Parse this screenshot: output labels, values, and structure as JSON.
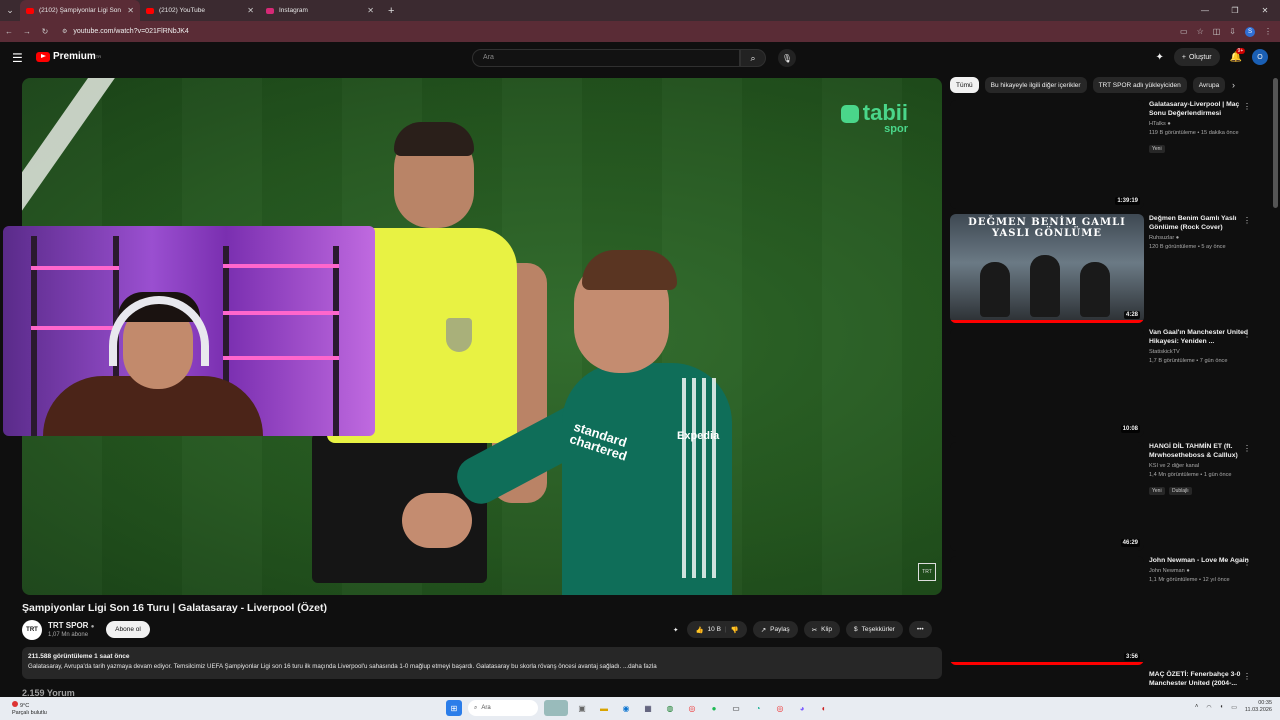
{
  "browser": {
    "tabs": [
      {
        "title": "(2102) Şampiyonlar Ligi Son 16",
        "active": true,
        "color": "#ff0000"
      },
      {
        "title": "(2102) YouTube",
        "active": false,
        "color": "#ff0000"
      },
      {
        "title": "Instagram",
        "active": false,
        "color": "#d62976"
      }
    ],
    "url": "youtube.com/watch?v=021FlRNbJK4",
    "profile_initial": "S"
  },
  "header": {
    "brand": "Premium",
    "brand_sup": "TR",
    "search_placeholder": "Ara",
    "create_label": "Oluştur",
    "notif_badge": "9+",
    "avatar_initial": "O"
  },
  "video": {
    "overlay_brand": "tabii",
    "overlay_sub": "spor",
    "sponsor": "standard chartered",
    "shirt_sponsor2": "Expedia",
    "watermark": "TRT",
    "title": "Şampiyonlar Ligi Son 16 Turu | Galatasaray - Liverpool (Özet)",
    "channel": {
      "name": "TRT SPOR",
      "subs": "1,07 Mn abone",
      "avatar_text": "TRT"
    },
    "subscribe_label": "Abone ol",
    "likes": "10 B",
    "share_label": "Paylaş",
    "clip_label": "Klip",
    "thanks_label": "Teşekkürler",
    "views_line": "211.588 görüntüleme  1 saat önce",
    "description": "Galatasaray, Avrupa'da tarih yazmaya devam ediyor. Temsilcimiz UEFA Şampiyonlar Ligi son 16 turu ilk maçında Liverpool'u sahasında 1-0 mağlup etmeyi başardı. Galatasaray bu skorla rövanş öncesi avantaj sağladı. ...daha fazla",
    "comments_peek": "2.159 Yorum"
  },
  "sidebar": {
    "chips": [
      "Tümü",
      "Bu hikayeyle ilgili diğer içerikler",
      "TRT SPOR adlı yükleyiciden",
      "Avrupa"
    ],
    "recs": [
      {
        "title": "Galatasaray-Liverpool | Maç Sonu Değerlendirmesi",
        "channel": "HTalks",
        "meta": "119 B görüntüleme • 15 dakika önce",
        "badge": "Yeni",
        "duration": "1:39:19"
      },
      {
        "title": "Değmen Benim Gamlı Yaslı Gönlüme (Rock Cover)",
        "channel": "Ruhsuzlar",
        "meta": "120 B görüntüleme • 5 ay önce",
        "badge": "",
        "duration": "4:28",
        "art": "DEĞMEN BENİM GAMLI YASLI GÖNLÜME"
      },
      {
        "title": "Van Gaal'ın Manchester United Hikayesi: Yeniden ...",
        "channel": "StatiskickTV",
        "meta": "1,7 B görüntüleme • 7 gün önce",
        "badge": "",
        "duration": "10:08"
      },
      {
        "title": "HANGİ DİL TAHMİN ET (ft. Mrwhosetheboss & Calllux)",
        "channel": "KSI ve 2 diğer kanal",
        "meta": "1,4 Mn görüntüleme • 1 gün önce",
        "badge": "Yeni",
        "badge2": "Dublajlı",
        "duration": "46:29"
      },
      {
        "title": "John Newman - Love Me Again",
        "channel": "John Newman",
        "meta": "1,1 Mr görüntüleme • 12 yıl önce",
        "badge": "",
        "duration": "3:56"
      },
      {
        "title": "MAÇ ÖZETİ: Fenerbahçe 3-0 Manchester United (2004-...",
        "channel": "",
        "meta": "",
        "badge": "",
        "duration": ""
      }
    ]
  },
  "taskbar": {
    "weather_temp": "9°C",
    "weather_desc": "Parçalı bulutlu",
    "search_label": "Ara",
    "time": "00:35",
    "date": "11.03.2026"
  }
}
